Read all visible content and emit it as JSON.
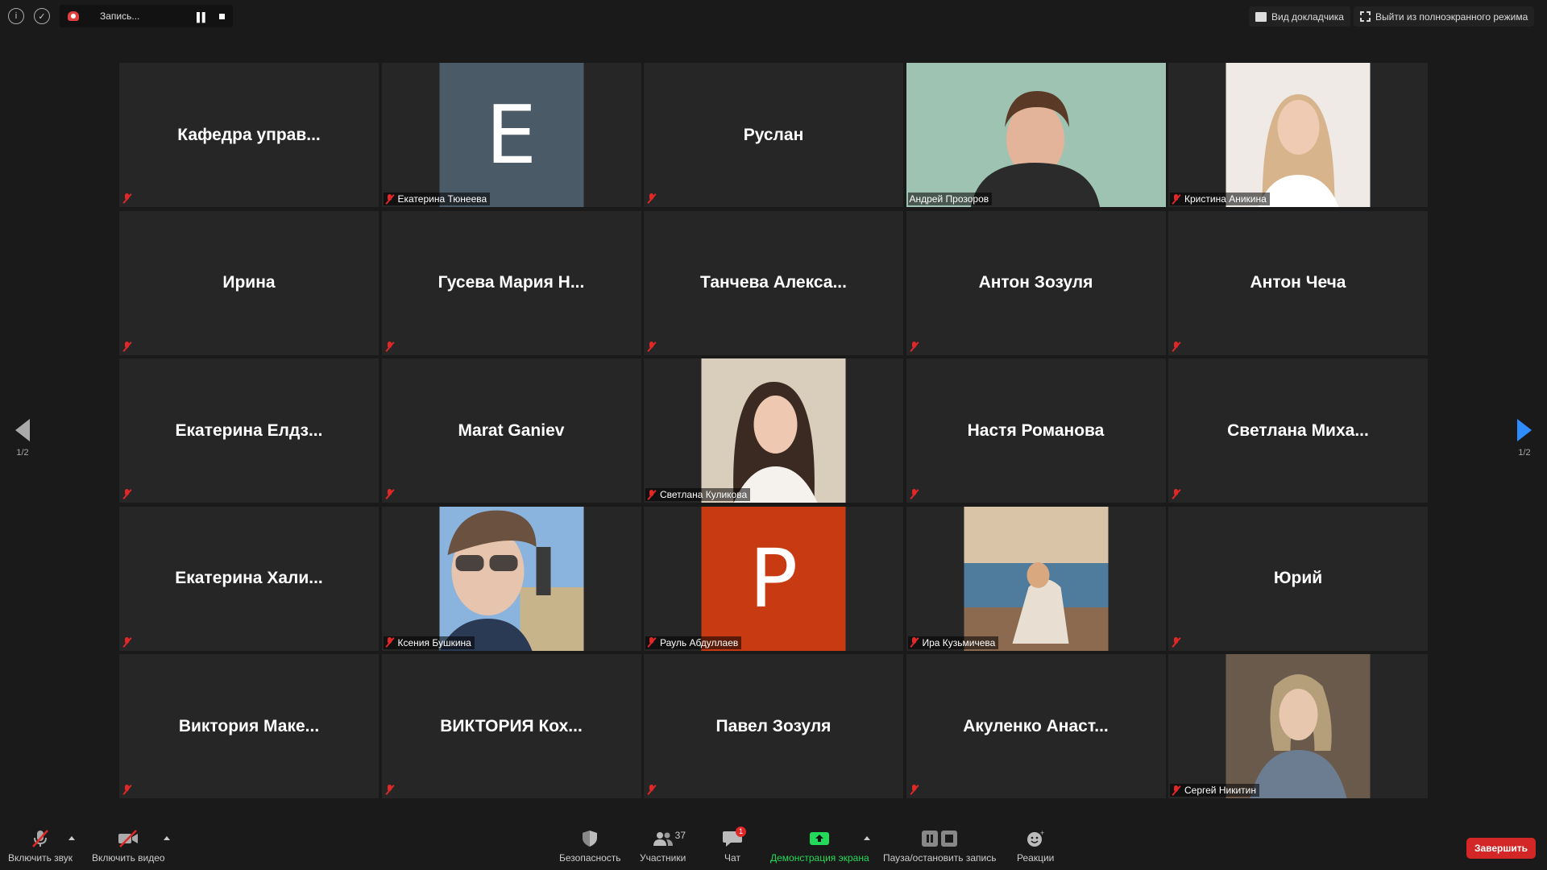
{
  "topbar": {
    "recording_label": "Запись...",
    "speaker_view_label": "Вид докладчика",
    "exit_fullscreen_label": "Выйти из полноэкранного режима"
  },
  "pagination": {
    "left": "1/2",
    "right": "1/2"
  },
  "participants": [
    {
      "display": "Кафедра управ...",
      "tag": ""
    },
    {
      "display": "",
      "tag": "Екатерина Тюнеева",
      "letter": "E",
      "color": "#4a5a66"
    },
    {
      "display": "Руслан",
      "tag": ""
    },
    {
      "display": "",
      "tag": "Андрей Прозоров",
      "video": "man"
    },
    {
      "display": "",
      "tag": "Кристина Аникина",
      "video": "woman1"
    },
    {
      "display": "Ирина",
      "tag": ""
    },
    {
      "display": "Гусева Мария Н...",
      "tag": ""
    },
    {
      "display": "Танчева Алекса...",
      "tag": ""
    },
    {
      "display": "Антон Зозуля",
      "tag": ""
    },
    {
      "display": "Антон Чеча",
      "tag": ""
    },
    {
      "display": "Екатерина Елдз...",
      "tag": ""
    },
    {
      "display": "Marat Ganiev",
      "tag": ""
    },
    {
      "display": "",
      "tag": "Светлана Куликова",
      "video": "woman2"
    },
    {
      "display": "Настя Романова",
      "tag": ""
    },
    {
      "display": "Светлана Миха...",
      "tag": ""
    },
    {
      "display": "Екатерина Хали...",
      "tag": ""
    },
    {
      "display": "",
      "tag": "Ксения Бушкина",
      "video": "selfie"
    },
    {
      "display": "",
      "tag": "Рауль Абдуллаев",
      "letter": "P",
      "color": "#c83a12"
    },
    {
      "display": "",
      "tag": "Ира Кузьмичева",
      "video": "beach"
    },
    {
      "display": "Юрий",
      "tag": ""
    },
    {
      "display": "Виктория Маке...",
      "tag": ""
    },
    {
      "display": "ВИКТОРИЯ Кох...",
      "tag": ""
    },
    {
      "display": "Павел Зозуля",
      "tag": ""
    },
    {
      "display": "Акуленко Анаст...",
      "tag": ""
    },
    {
      "display": "",
      "tag": "Сергей Никитин",
      "video": "man2"
    }
  ],
  "toolbar": {
    "unmute_label": "Включить звук",
    "start_video_label": "Включить видео",
    "security_label": "Безопасность",
    "participants_label": "Участники",
    "participants_count": "37",
    "chat_label": "Чат",
    "chat_badge": "1",
    "share_label": "Демонстрация экрана",
    "pause_record_label": "Пауза/остановить запись",
    "reactions_label": "Реакции",
    "end_label": "Завершить"
  },
  "colors": {
    "active_speaker": "#c7e86a",
    "share_green": "#23d959",
    "end_red": "#d32626",
    "mic_off": "#e02828",
    "nav_blue": "#2e8cff"
  }
}
